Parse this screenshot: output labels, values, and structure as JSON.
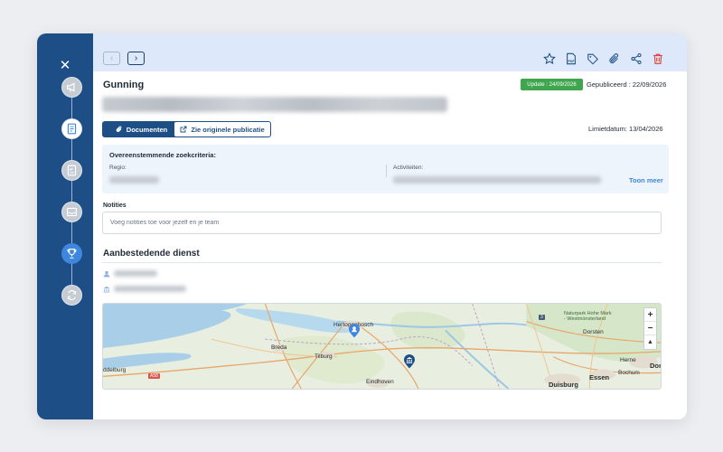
{
  "sidebar": {
    "close_label": "✕",
    "steps": [
      {
        "icon": "megaphone-icon",
        "state": "done"
      },
      {
        "icon": "document-icon",
        "state": "current"
      },
      {
        "icon": "checklist-icon",
        "state": "done"
      },
      {
        "icon": "inbox-icon",
        "state": "done"
      },
      {
        "icon": "trophy-icon",
        "state": "active"
      },
      {
        "icon": "refresh-icon",
        "state": "done"
      }
    ]
  },
  "toolbar": {
    "back_label": "‹",
    "forward_label": "›",
    "icons": [
      "star-icon",
      "pdf-icon",
      "tag-icon",
      "paperclip-icon",
      "share-icon",
      "trash-icon"
    ],
    "pdf_text": "PDF"
  },
  "header": {
    "type": "Gunning",
    "update_badge": "Update : 24/09/2026",
    "published": "Gepubliceerd : 22/09/2026"
  },
  "actions": {
    "documents_label": "Documenten",
    "original_label": "Zie originele publicatie",
    "deadline": "Limietdatum:  13/04/2026"
  },
  "criteria": {
    "title": "Overeenstemmende zoekcriteria:",
    "region_label": "Regio:",
    "activities_label": "Activiteiten:",
    "more_label": "Toon meer"
  },
  "notes": {
    "label": "Notities",
    "placeholder": "Voeg notities toe voor jezelf en je team"
  },
  "authority": {
    "title": "Aanbestedende dienst"
  },
  "map": {
    "labels": {
      "hertogenbosch": "Hertogenbosch",
      "breda": "Breda",
      "tilburg": "Tilburg",
      "eindhoven": "Eindhoven",
      "middelburg": "ddelburg",
      "dorsten": "Dorsten",
      "herne": "Herne",
      "essen": "Essen",
      "bochum": "Bochum",
      "duisburg": "Duisburg",
      "dortmund": "Dort",
      "naturpark": "Naturpark Hohe Mark\n- Westmünsterland",
      "a58": "A58",
      "route3": "3"
    },
    "zoom_in": "+",
    "zoom_out": "−",
    "compass": "▲"
  },
  "colors": {
    "sidebar": "#1d4f86",
    "topbar": "#dde9fb",
    "accent": "#3f86de",
    "badge": "#3fa64f",
    "danger": "#e0443e"
  }
}
